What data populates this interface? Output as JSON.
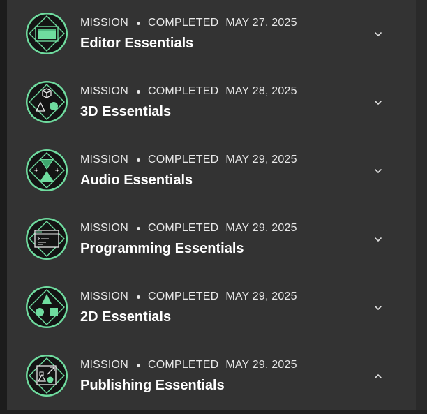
{
  "missions": [
    {
      "type": "MISSION",
      "status": "COMPLETED",
      "date": "MAY 27, 2025",
      "title": "Editor Essentials",
      "icon": "editor-icon",
      "expanded": false
    },
    {
      "type": "MISSION",
      "status": "COMPLETED",
      "date": "MAY 28, 2025",
      "title": "3D Essentials",
      "icon": "3d-shapes-icon",
      "expanded": false
    },
    {
      "type": "MISSION",
      "status": "COMPLETED",
      "date": "MAY 29, 2025",
      "title": "Audio Essentials",
      "icon": "hourglass-icon",
      "expanded": false
    },
    {
      "type": "MISSION",
      "status": "COMPLETED",
      "date": "MAY 29, 2025",
      "title": "Programming Essentials",
      "icon": "code-window-icon",
      "expanded": false
    },
    {
      "type": "MISSION",
      "status": "COMPLETED",
      "date": "MAY 29, 2025",
      "title": "2D Essentials",
      "icon": "2d-shapes-icon",
      "expanded": false
    },
    {
      "type": "MISSION",
      "status": "COMPLETED",
      "date": "MAY 29, 2025",
      "title": "Publishing Essentials",
      "icon": "publish-icon",
      "expanded": true
    }
  ],
  "colors": {
    "accent": "#6fdc9f",
    "background": "#333333"
  }
}
